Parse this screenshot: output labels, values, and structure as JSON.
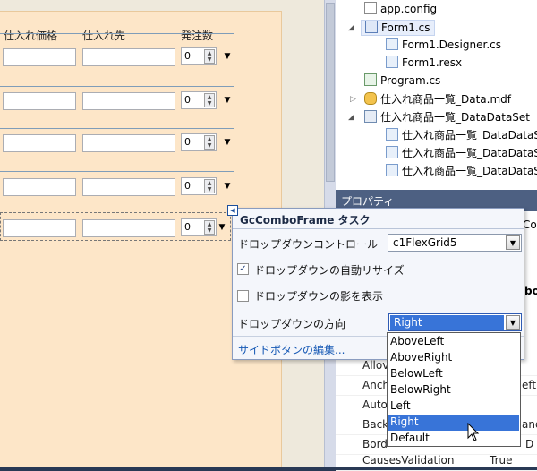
{
  "designer": {
    "columns": {
      "price": "仕入れ価格",
      "supplier": "仕入れ先",
      "order_qty": "発注数"
    },
    "rows": [
      {
        "qty": "0"
      },
      {
        "qty": "0"
      },
      {
        "qty": "0"
      },
      {
        "qty": "0"
      },
      {
        "qty": "0"
      }
    ]
  },
  "solution": {
    "items": [
      {
        "label": "app.config",
        "icon": "config-file-icon"
      },
      {
        "label": "Form1.cs",
        "icon": "form-icon"
      },
      {
        "label": "Form1.Designer.cs",
        "icon": "cs-file-icon"
      },
      {
        "label": "Form1.resx",
        "icon": "resx-file-icon"
      },
      {
        "label": "Program.cs",
        "icon": "cs-file-icon"
      },
      {
        "label": "仕入れ商品一覧_Data.mdf",
        "icon": "database-icon"
      },
      {
        "label": "仕入れ商品一覧_DataDataSet",
        "icon": "dataset-icon"
      },
      {
        "label": "仕入れ商品一覧_DataDataS",
        "icon": "cs-file-icon"
      },
      {
        "label": "仕入れ商品一覧_DataDataS",
        "icon": "cs-file-icon"
      },
      {
        "label": "仕入れ商品一覧_DataDataS",
        "icon": "cs-file-icon"
      }
    ]
  },
  "properties": {
    "title": "プロパティ",
    "object_name_fragment": "Co",
    "category_fragment": "bo",
    "rows": [
      {
        "name": "Allov",
        "value": ""
      },
      {
        "name": "Anch",
        "value": "eft"
      },
      {
        "name": "Auto",
        "value": ""
      },
      {
        "name": "Back",
        "value": "and"
      },
      {
        "name": "Bord",
        "value": "D"
      },
      {
        "name": "CausesValidation",
        "value": "True"
      }
    ]
  },
  "task_panel": {
    "title": "GcComboFrame タスク",
    "dropdown_control_label": "ドロップダウンコントロール",
    "dropdown_control_value": "c1FlexGrid5",
    "auto_resize_label": "ドロップダウンの自動リサイズ",
    "auto_resize_checked": true,
    "shadow_label": "ドロップダウンの影を表示",
    "shadow_checked": false,
    "direction_label": "ドロップダウンの方向",
    "direction_value": "Right",
    "side_button_link": "サイドボタンの編集..."
  },
  "direction_options": [
    "AboveLeft",
    "AboveRight",
    "BelowLeft",
    "BelowRight",
    "Left",
    "Right",
    "Default"
  ],
  "direction_highlighted": "Right",
  "colors": {
    "form_background": "#fde6c8",
    "selection_blue": "#3874d8",
    "panel_header": "#4d6082"
  }
}
